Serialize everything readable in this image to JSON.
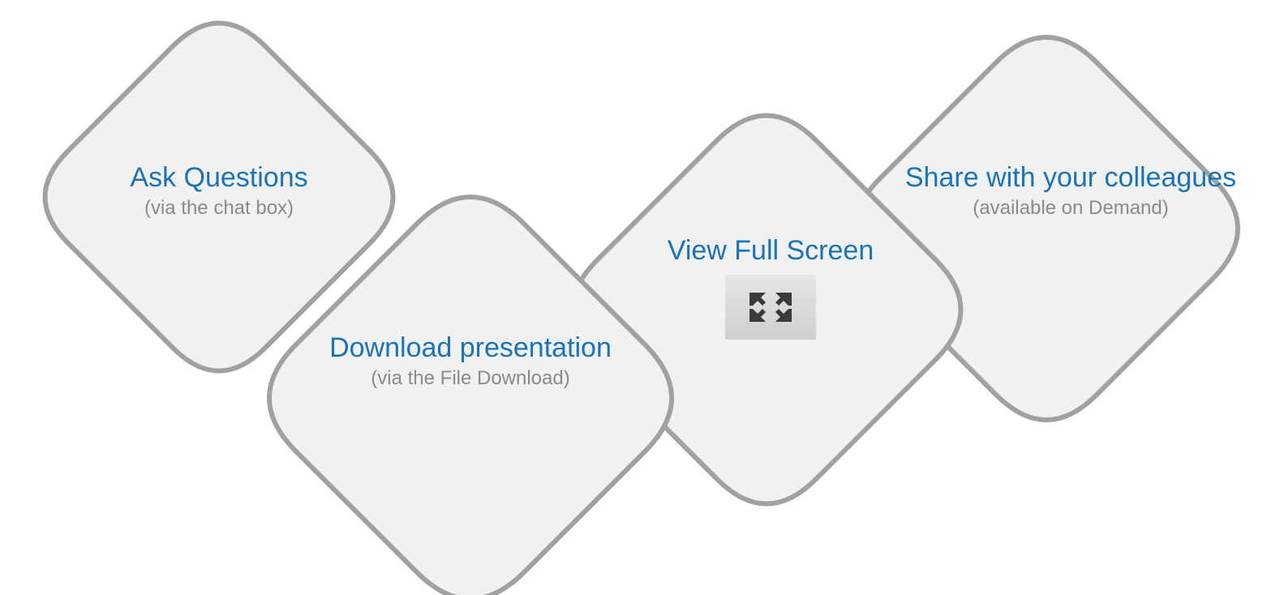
{
  "items": [
    {
      "title": "Ask Questions",
      "subtitle": "(via the chat box)"
    },
    {
      "title": "Download presentation",
      "subtitle": "(via the File Download)"
    },
    {
      "title": "View Full Screen",
      "subtitle": ""
    },
    {
      "title": "Share with your colleagues",
      "subtitle": "(available on Demand)"
    }
  ],
  "icons": {
    "fullscreen": "fullscreen-icon"
  },
  "colors": {
    "title": "#1a73b8",
    "subtitle": "#8a8a8a",
    "shape_fill": "#f1f1f1",
    "shape_stroke": "#a1a1a1"
  }
}
